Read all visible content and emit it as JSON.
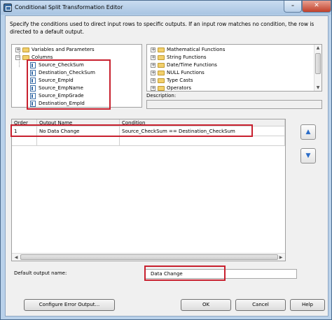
{
  "window": {
    "title": "Conditional Split Transformation Editor",
    "minimize_glyph": "–",
    "close_glyph": "✕"
  },
  "instructions": "Specify the conditions used to direct input rows to specific outputs. If an input row matches no condition, the row is directed to a default output.",
  "left_tree": {
    "nodes": [
      {
        "label": "Variables and Parameters",
        "expander": "+"
      },
      {
        "label": "Columns",
        "expander": "−"
      }
    ],
    "columns": [
      "Source_CheckSum",
      "Destination_CheckSum",
      "Source_EmpId",
      "Source_EmpName",
      "Source_EmpGrade",
      "Destination_EmpId"
    ]
  },
  "right_tree": {
    "nodes": [
      "Mathematical Functions",
      "String Functions",
      "Date/Time Functions",
      "NULL Functions",
      "Type Casts",
      "Operators"
    ],
    "expander": "+"
  },
  "description": {
    "label": "Description:",
    "value": ""
  },
  "grid": {
    "headers": [
      "Order",
      "Output Name",
      "Condition"
    ],
    "rows": [
      {
        "order": "1",
        "output_name": "No Data Change",
        "condition": "Source_CheckSum == Destination_CheckSum"
      }
    ]
  },
  "move_buttons": {
    "up": "▲",
    "down": "▼"
  },
  "default_output": {
    "label": "Default output name:",
    "value": "Data Change"
  },
  "buttons": {
    "configure": "Configure Error Output...",
    "ok": "OK",
    "cancel": "Cancel",
    "help": "Help"
  },
  "colors": {
    "highlight": "#c8202e",
    "title_bar": "#b9d1ea",
    "dialog_bg": "#f0f0f0"
  }
}
